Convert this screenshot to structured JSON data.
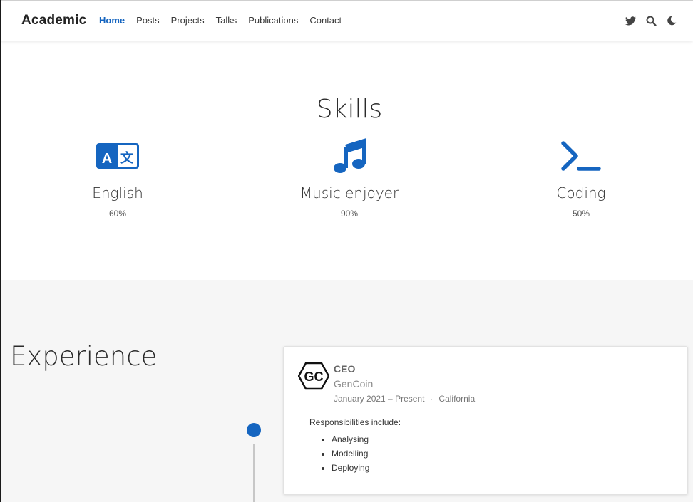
{
  "navbar": {
    "brand": "Academic",
    "links": [
      "Home",
      "Posts",
      "Projects",
      "Talks",
      "Publications",
      "Contact"
    ],
    "icons": [
      "twitter-icon",
      "search-icon",
      "moon-icon"
    ]
  },
  "skills": {
    "title": "Skills",
    "items": [
      {
        "name": "English",
        "percent": "60%",
        "icon": "language-icon"
      },
      {
        "name": "Music enjoyer",
        "percent": "90%",
        "icon": "music-note-icon"
      },
      {
        "name": "Coding",
        "percent": "50%",
        "icon": "terminal-icon"
      }
    ]
  },
  "experience": {
    "title": "Experience",
    "entries": [
      {
        "logo_text": "GC",
        "role": "CEO",
        "company": "GenCoin",
        "dates": "January 2021 – Present",
        "location": "California",
        "responsibilities_intro": "Responsibilities include:",
        "responsibilities": [
          "Analysing",
          "Modelling",
          "Deploying"
        ]
      }
    ]
  },
  "colors": {
    "accent": "#1565c0",
    "section_bg": "#f6f6f6"
  }
}
